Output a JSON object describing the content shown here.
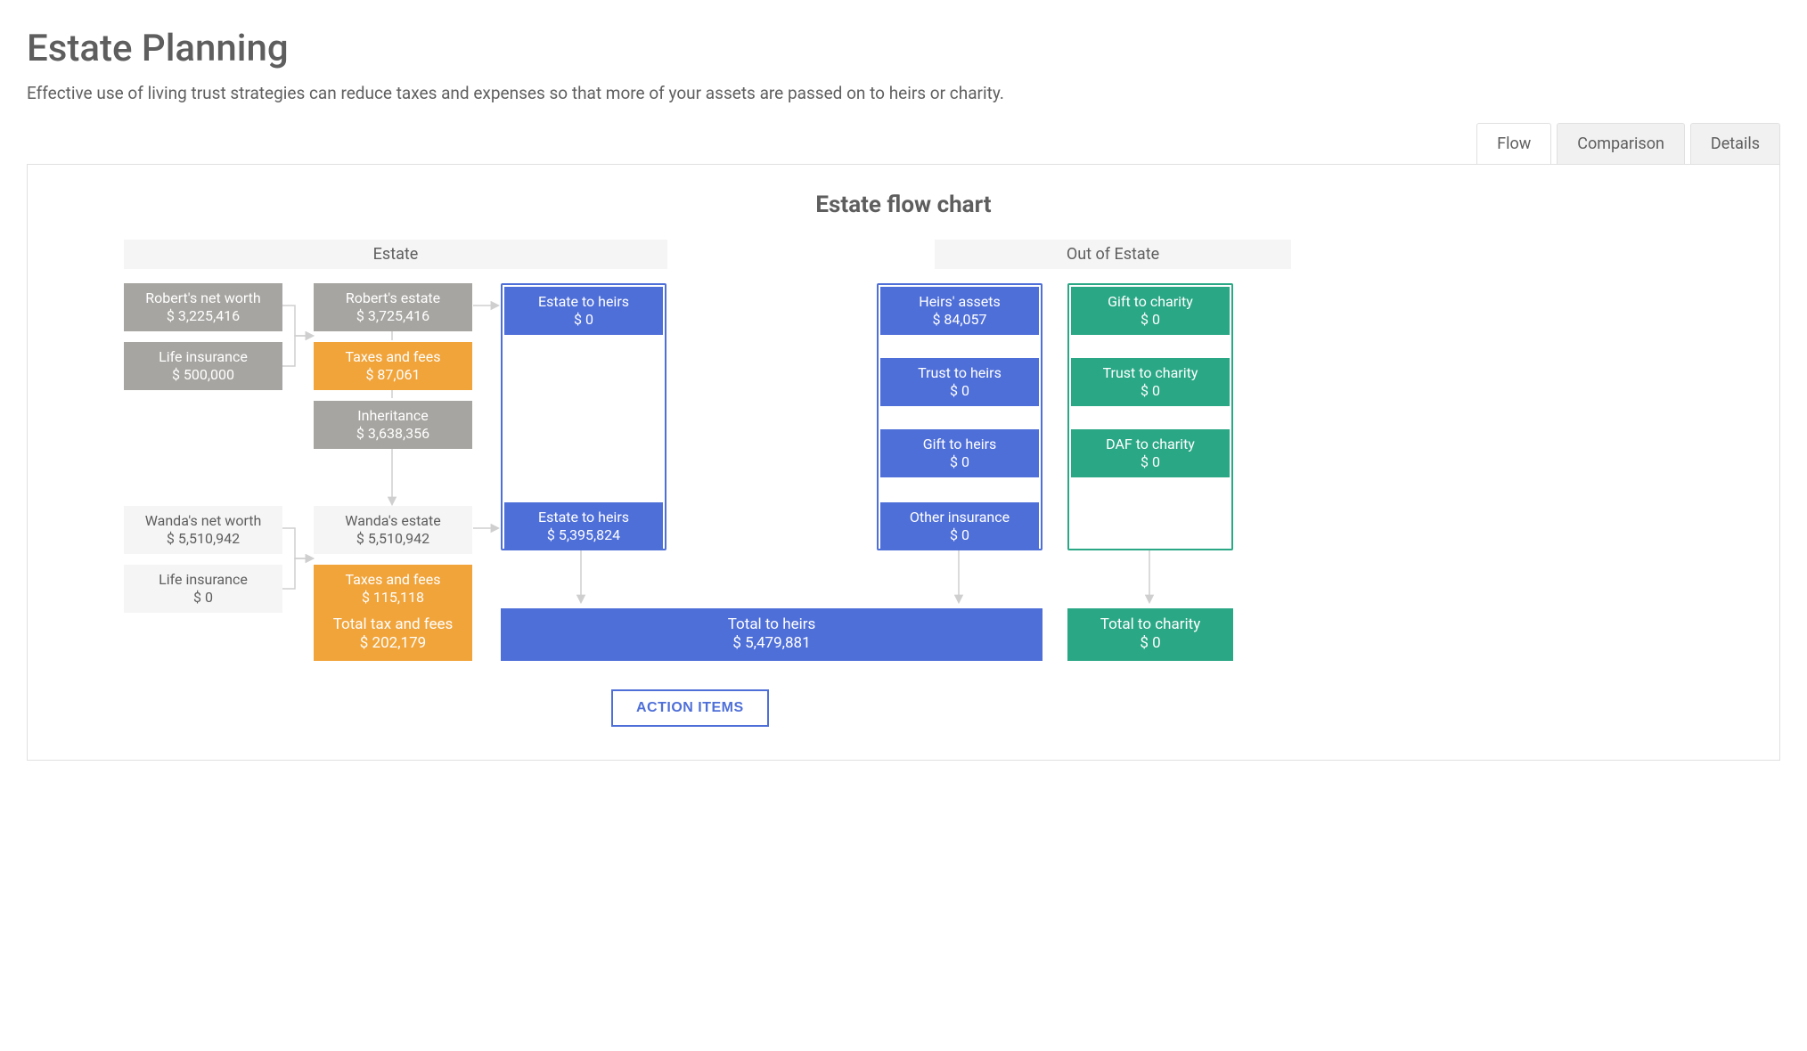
{
  "page": {
    "title": "Estate Planning",
    "subtitle": "Effective use of living trust strategies can reduce taxes and expenses so that more of your assets are passed on to heirs or charity."
  },
  "tabs": {
    "flow": "Flow",
    "comparison": "Comparison",
    "details": "Details"
  },
  "chart": {
    "title": "Estate flow chart",
    "header_estate": "Estate",
    "header_out": "Out of Estate",
    "action_button": "ACTION ITEMS"
  },
  "nodes": {
    "robert_networth": {
      "label": "Robert's net worth",
      "value": "$ 3,225,416"
    },
    "robert_life_ins": {
      "label": "Life insurance",
      "value": "$ 500,000"
    },
    "robert_estate": {
      "label": "Robert's estate",
      "value": "$ 3,725,416"
    },
    "robert_taxes": {
      "label": "Taxes and fees",
      "value": "$ 87,061"
    },
    "inheritance": {
      "label": "Inheritance",
      "value": "$ 3,638,356"
    },
    "wanda_networth": {
      "label": "Wanda's net worth",
      "value": "$ 5,510,942"
    },
    "wanda_life_ins": {
      "label": "Life insurance",
      "value": "$ 0"
    },
    "wanda_estate": {
      "label": "Wanda's estate",
      "value": "$ 5,510,942"
    },
    "wanda_taxes": {
      "label": "Taxes and fees",
      "value": "$ 115,118"
    },
    "total_taxes": {
      "label": "Total tax and fees",
      "value": "$ 202,179"
    },
    "estate_heirs_1": {
      "label": "Estate to heirs",
      "value": "$ 0"
    },
    "estate_heirs_2": {
      "label": "Estate to heirs",
      "value": "$ 5,395,824"
    },
    "heirs_assets": {
      "label": "Heirs' assets",
      "value": "$ 84,057"
    },
    "trust_heirs": {
      "label": "Trust to heirs",
      "value": "$ 0"
    },
    "gift_heirs": {
      "label": "Gift to heirs",
      "value": "$ 0"
    },
    "other_ins": {
      "label": "Other insurance",
      "value": "$ 0"
    },
    "gift_charity": {
      "label": "Gift to charity",
      "value": "$ 0"
    },
    "trust_charity": {
      "label": "Trust to charity",
      "value": "$ 0"
    },
    "daf_charity": {
      "label": "DAF to charity",
      "value": "$ 0"
    },
    "total_heirs": {
      "label": "Total to heirs",
      "value": "$ 5,479,881"
    },
    "total_charity": {
      "label": "Total to charity",
      "value": "$ 0"
    }
  },
  "chart_data": {
    "type": "flow",
    "groups": [
      {
        "name": "Estate",
        "nodes": [
          "robert_networth",
          "robert_life_ins",
          "robert_estate",
          "robert_taxes",
          "inheritance",
          "wanda_networth",
          "wanda_life_ins",
          "wanda_estate",
          "wanda_taxes",
          "total_taxes",
          "estate_heirs_1",
          "estate_heirs_2"
        ]
      },
      {
        "name": "Out of Estate",
        "nodes": [
          "heirs_assets",
          "trust_heirs",
          "gift_heirs",
          "other_ins",
          "gift_charity",
          "trust_charity",
          "daf_charity"
        ]
      }
    ],
    "edges": [
      [
        "robert_networth",
        "robert_estate"
      ],
      [
        "robert_life_ins",
        "robert_estate"
      ],
      [
        "robert_estate",
        "robert_taxes"
      ],
      [
        "robert_taxes",
        "inheritance"
      ],
      [
        "robert_estate",
        "estate_heirs_1"
      ],
      [
        "inheritance",
        "wanda_estate"
      ],
      [
        "wanda_networth",
        "wanda_estate"
      ],
      [
        "wanda_life_ins",
        "wanda_estate"
      ],
      [
        "wanda_estate",
        "wanda_taxes"
      ],
      [
        "wanda_estate",
        "estate_heirs_2"
      ],
      [
        "wanda_taxes",
        "total_taxes"
      ],
      [
        "estate_heirs_2",
        "total_heirs"
      ],
      [
        "other_ins",
        "total_heirs"
      ],
      [
        "daf_charity",
        "total_charity"
      ]
    ],
    "totals": [
      {
        "id": "total_heirs",
        "value": 5479881
      },
      {
        "id": "total_charity",
        "value": 0
      },
      {
        "id": "total_taxes",
        "value": 202179
      }
    ]
  }
}
